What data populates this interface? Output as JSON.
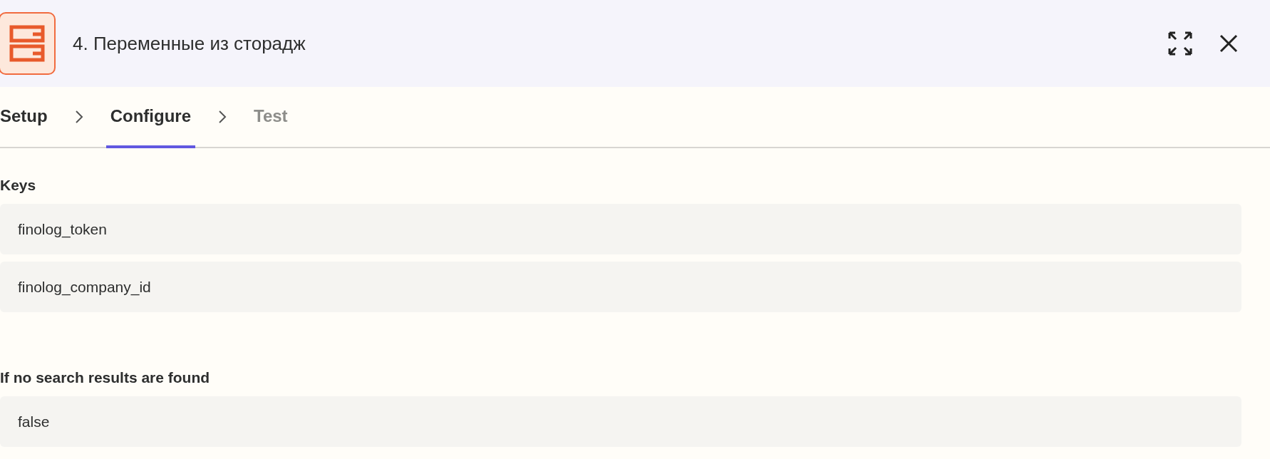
{
  "header": {
    "title": "4. Переменные из сторадж"
  },
  "steps": [
    {
      "label": "Setup",
      "selected": false,
      "disabled": false
    },
    {
      "label": "Configure",
      "selected": true,
      "disabled": false
    },
    {
      "label": "Test",
      "selected": false,
      "disabled": true
    }
  ],
  "sections": [
    {
      "label": "Keys",
      "fields": [
        "finolog_token",
        "finolog_company_id"
      ]
    },
    {
      "label": "If no search results are found",
      "fields": [
        "false"
      ]
    }
  ]
}
